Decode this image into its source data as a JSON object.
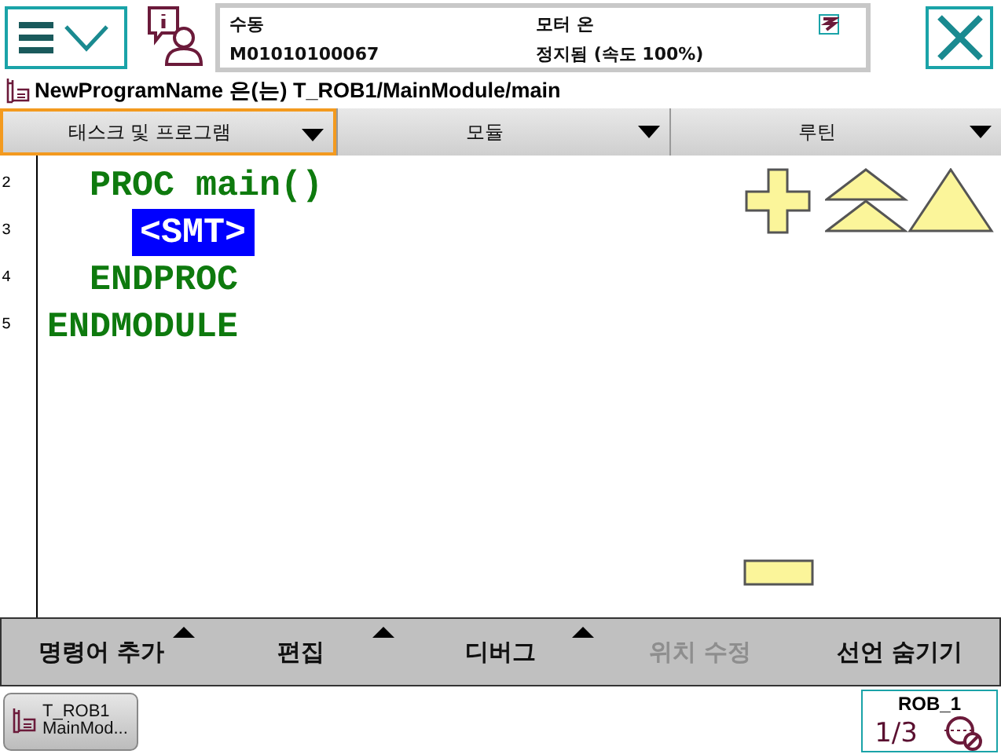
{
  "status": {
    "mode": "수동",
    "controller": "M01010100067",
    "motor": "모터 온",
    "state": "정지됨 (속도 100%)"
  },
  "path": "NewProgramName 은(는) T_ROB1/MainModule/main",
  "selectors": [
    {
      "label": "태스크 및 프로그램",
      "selected": true
    },
    {
      "label": "모듈",
      "selected": false
    },
    {
      "label": "루틴",
      "selected": false
    }
  ],
  "code": [
    {
      "number": "2",
      "text": "  PROC main()",
      "selected": false,
      "children": [
        {
          "number": "3",
          "text": "<SMT>",
          "selected": true
        }
      ]
    },
    {
      "number": "4",
      "text": "  ENDPROC",
      "selected": false
    },
    {
      "number": "5",
      "text": "ENDMODULE",
      "selected": false
    }
  ],
  "menu": [
    {
      "label": "명령어 추가",
      "submenu": true,
      "disabled": false
    },
    {
      "label": "편집",
      "submenu": true,
      "disabled": false
    },
    {
      "label": "디버그",
      "submenu": true,
      "disabled": false
    },
    {
      "label": "위치 수정",
      "submenu": false,
      "disabled": true
    },
    {
      "label": "선언 숨기기",
      "submenu": false,
      "disabled": false
    }
  ],
  "taskbar": {
    "app": [
      "T_ROB1",
      "MainMod..."
    ],
    "unit": "ROB_1",
    "fraction": "1/3"
  }
}
